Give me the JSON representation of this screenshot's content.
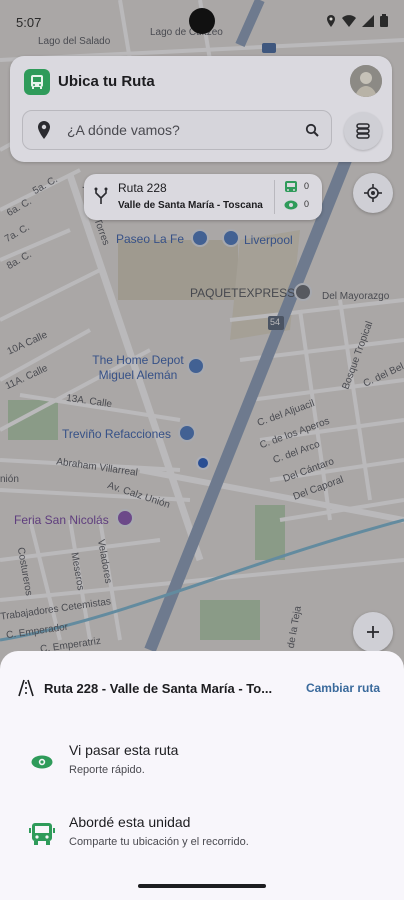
{
  "status_bar": {
    "time": "5:07"
  },
  "header": {
    "app_title": "Ubica tu Ruta",
    "search_placeholder": "¿A dónde vamos?"
  },
  "route_chip": {
    "name": "Ruta 228",
    "subtitle": "Valle de Santa María - Toscana",
    "bus_count": "0",
    "seen_count": "0"
  },
  "map": {
    "streets": [
      "Lago del Salado",
      "Lago de Cuitzeo",
      "5a. C.",
      "7a. C.",
      "6a. C.",
      "8a. C.",
      "Av. Las Torres",
      "Del Mayorazgo",
      "Bosque Tropical",
      "C. del Bel",
      "C. del Aljuacil",
      "C. de los Aperos",
      "C. del Arco",
      "Del Cántaro",
      "Del Caporal",
      "10A Calle",
      "11A. Calle",
      "13A. Calle",
      "Abraham Villarreal",
      "Av. Calz Unión",
      "Veladores",
      "Meseros",
      "Costureros",
      "Trabajadores Cetemistas",
      "C. Emperador",
      "C. Emperatriz",
      "C. de la Teja",
      "nión"
    ],
    "pois": [
      "Paseo La Fe",
      "Liverpool",
      "PAQUETEXPRESS",
      "The Home Depot Miguel Alemán",
      "Treviño Refacciones",
      "Feria San Nicolás"
    ],
    "highway_shield": "54"
  },
  "sheet": {
    "route_title": "Ruta 228 - Valle de Santa María - To...",
    "change_route": "Cambiar ruta",
    "options": [
      {
        "title": "Vi pasar esta ruta",
        "subtitle": "Reporte rápido."
      },
      {
        "title": "Abordé esta unidad",
        "subtitle": "Comparte tu ubicación y el recorrido."
      }
    ]
  },
  "colors": {
    "accent_green": "#2f9b5a",
    "link_blue": "#3a6a9c"
  }
}
